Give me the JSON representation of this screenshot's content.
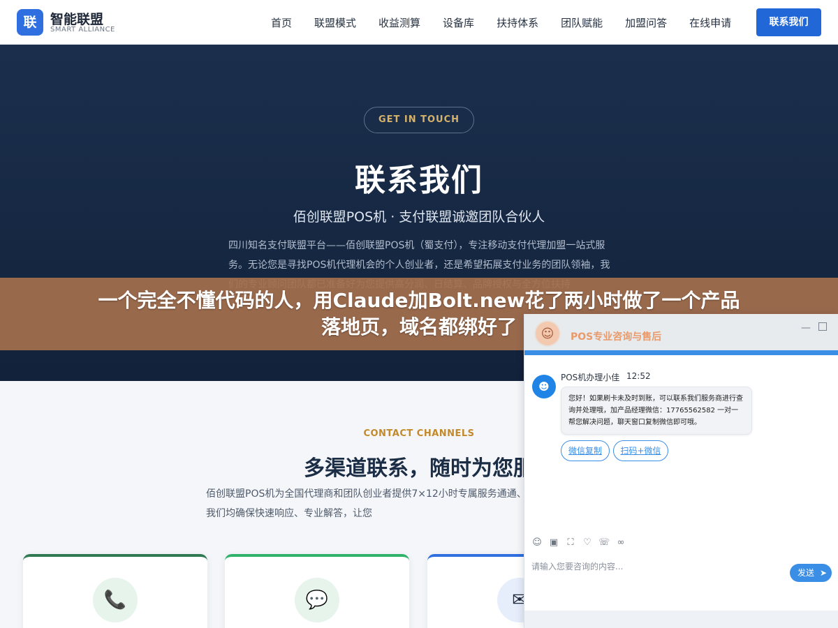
{
  "header": {
    "logo_mark": "联",
    "logo_title": "智能联盟",
    "logo_subtitle": "SMART ALLIANCE",
    "nav": [
      "首页",
      "联盟模式",
      "收益测算",
      "设备库",
      "扶持体系",
      "团队赋能",
      "加盟问答",
      "在线申请"
    ],
    "cta": "联系我们",
    "cta_color": "#2167d8"
  },
  "hero": {
    "pill": "GET IN TOUCH",
    "title": "联系我们",
    "subtitle": "佰创联盟POS机 · 支付联盟诚邀团队合伙人",
    "description": "四川知名支付联盟平台——佰创联盟POS机（蜀支付），专注移动支付代理加盟一站式服务。无论您是寻找POS机代理机会的个人创业者，还是希望拓展支付业务的团队领袖，我们的专业顾问团队都已准备好为您提供高分润、日结算、品牌授权与全方位扶持"
  },
  "banner": {
    "line1": "一个完全不懂代码的人，用Claude加Bolt.new花了两小时做了一个产品",
    "line2": "落地页，域名都绑好了"
  },
  "channels": {
    "label": "CONTACT CHANNELS",
    "title": "多渠道联系，随时为您服",
    "description": "佰创联盟POS机为全国代理商和团队创业者提供7×12小时专属服务通通、微信交流还是邮件咨询，我们均确保快速响应、专业解答，让您",
    "cards": [
      {
        "icon": "phone-icon",
        "glyph": "📞"
      },
      {
        "icon": "chat-icon",
        "glyph": "💬"
      },
      {
        "icon": "mail-icon",
        "glyph": "✉"
      }
    ]
  },
  "chat": {
    "header_title": "POS专业咨询与售后",
    "min_glyph": "—",
    "agent_name": "POS机办理小佳",
    "time": "12:52",
    "message": "您好！如果刷卡未及时到账，可以联系我们服务商进行查询并处理哦，加产品经理微信：17765562582 一对一帮您解决问题，聊天窗口复制微信即可哦。",
    "chip1": "微信复制",
    "chip2": "扫码+微信",
    "input_placeholder": "请输入您要咨询的内容...",
    "send": "发送",
    "accent": "#3a8ee6",
    "tools": [
      "emoji-icon",
      "image-icon",
      "screenshot-icon",
      "rating-icon",
      "transfer-icon",
      "wechat-icon"
    ]
  }
}
